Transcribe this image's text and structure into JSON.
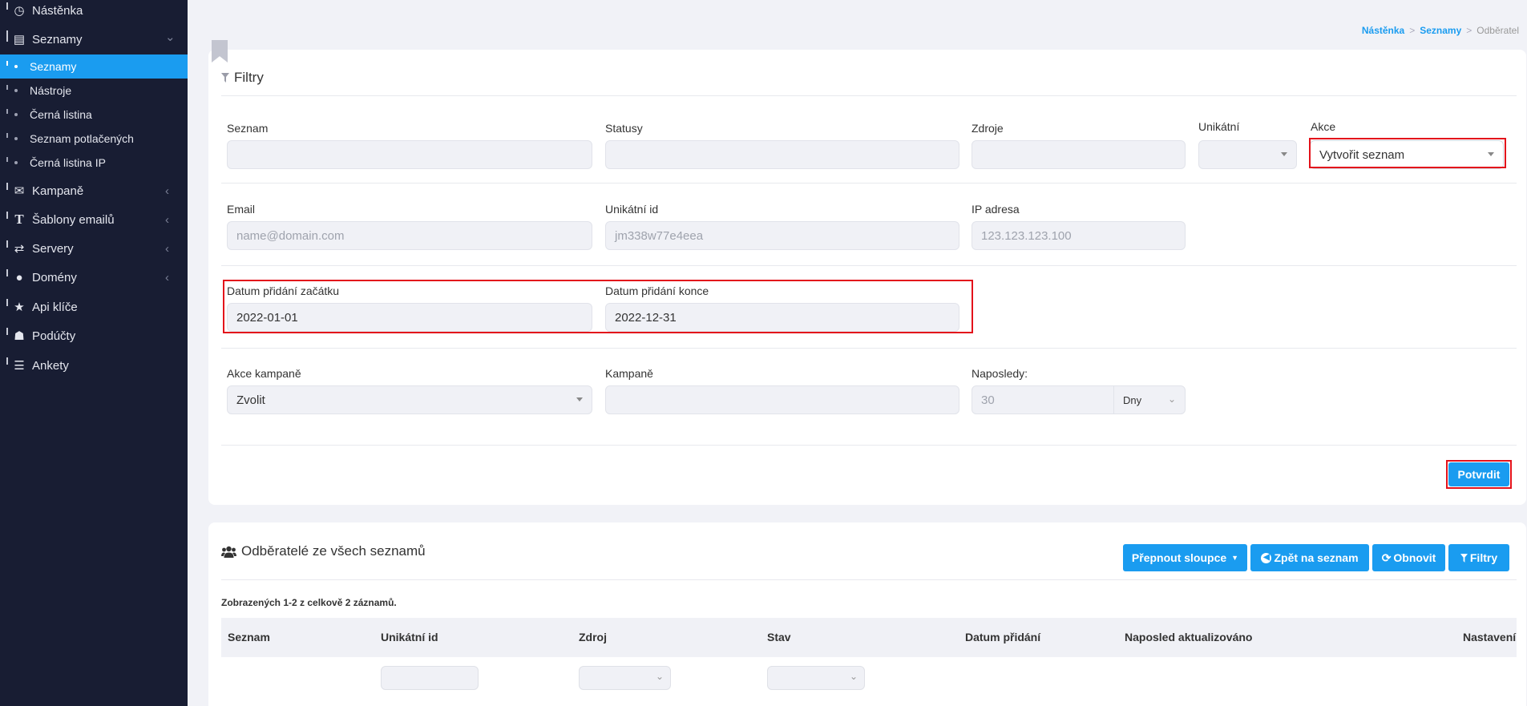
{
  "sidebar": {
    "items": [
      {
        "icon": "dashboard-icon",
        "glyph": "◷",
        "label": "Nástěnka"
      },
      {
        "icon": "list-icon",
        "glyph": "▤",
        "label": "Seznamy",
        "chevron": "⌄"
      },
      {
        "icon": "envelope-icon",
        "glyph": "✉",
        "label": "Kampaně",
        "chevron": "‹"
      },
      {
        "icon": "text-icon",
        "glyph": "T",
        "label": "Šablony emailů",
        "chevron": "‹"
      },
      {
        "icon": "exchange-icon",
        "glyph": "⇄",
        "label": "Servery",
        "chevron": "‹"
      },
      {
        "icon": "globe-icon",
        "glyph": "●",
        "label": "Domény",
        "chevron": "‹"
      },
      {
        "icon": "star-icon",
        "glyph": "★",
        "label": "Api klíče"
      },
      {
        "icon": "users-icon",
        "glyph": "☗",
        "label": "Podúčty"
      },
      {
        "icon": "list-ul-icon",
        "glyph": "☰",
        "label": "Ankety"
      }
    ],
    "subitems": [
      {
        "label": "Seznamy",
        "active": true
      },
      {
        "label": "Nástroje"
      },
      {
        "label": "Černá listina"
      },
      {
        "label": "Seznam potlačených"
      },
      {
        "label": "Černá listina IP"
      }
    ]
  },
  "breadcrumb": {
    "home": "Nástěnka",
    "sep": ">",
    "lists": "Seznamy",
    "current": "Odběratel"
  },
  "filters": {
    "title": "Filtry",
    "icon": "filter-icon",
    "seznam_label": "Seznam",
    "statusy_label": "Statusy",
    "zdroje_label": "Zdroje",
    "unikatni_label": "Unikátní",
    "akce_label": "Akce",
    "akce_value": "Vytvořit seznam",
    "email_label": "Email",
    "email_placeholder": "name@domain.com",
    "uid_label": "Unikátní id",
    "uid_placeholder": "jm338w77e4eea",
    "ip_label": "IP adresa",
    "ip_placeholder": "123.123.123.100",
    "date_start_label": "Datum přidání začátku",
    "date_start_value": "2022-01-01",
    "date_end_label": "Datum přidání konce",
    "date_end_value": "2022-12-31",
    "akce_kampane_label": "Akce kampaně",
    "akce_kampane_value": "Zvolit",
    "kampane_label": "Kampaně",
    "naposledy_label": "Naposledy:",
    "naposledy_value": "30",
    "naposledy_unit": "Dny",
    "confirm": "Potvrdit"
  },
  "subscribers": {
    "title": "Odběratelé ze všech seznamů",
    "icon": "users-icon",
    "btn_columns": "Přepnout sloupce",
    "btn_back": "Zpět na seznam",
    "btn_refresh": "Obnovit",
    "btn_filters": "Filtry",
    "summary": "Zobrazených 1-2 z celkově 2 záznamů.",
    "columns": [
      "Seznam",
      "Unikátní id",
      "Zdroj",
      "Stav",
      "Datum přidání",
      "Naposled aktualizováno",
      "Nastavení"
    ]
  },
  "colors": {
    "accent": "#1a9cf0",
    "sidebar": "#181d33",
    "highlight": "#e3121b"
  }
}
